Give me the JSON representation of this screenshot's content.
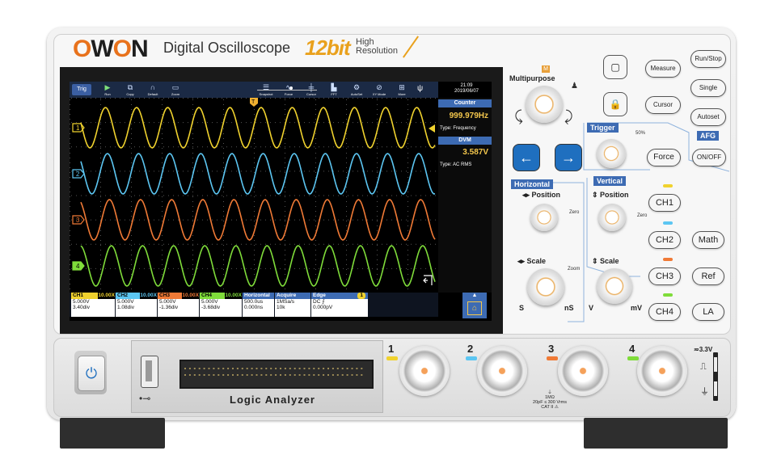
{
  "brand": {
    "logo": "OWON",
    "product": "Digital Oscilloscope",
    "bits": "12bit",
    "hires_line1": "High",
    "hires_line2": "Resolution"
  },
  "toolbar": {
    "trig": "Trig",
    "items": [
      {
        "icon": "play-icon",
        "label": "Run"
      },
      {
        "icon": "copy-icon",
        "label": "Copy"
      },
      {
        "icon": "default-icon",
        "label": "Default"
      },
      {
        "icon": "zoom-icon",
        "label": "Zoom"
      }
    ],
    "right_items": [
      {
        "icon": "snapshot-icon",
        "label": "Snapshot"
      },
      {
        "icon": "force-icon",
        "label": "Force"
      },
      {
        "icon": "cursor-icon",
        "label": "Cursor"
      },
      {
        "icon": "fft-icon",
        "label": "FFT"
      },
      {
        "icon": "autoset-icon",
        "label": "AutoSet"
      },
      {
        "icon": "xy-mode-icon",
        "label": "XY Mode"
      },
      {
        "icon": "more-icon",
        "label": "More"
      }
    ],
    "usb": "ψ",
    "time": "21:09",
    "date": "2019/06/07"
  },
  "trigger_marker": "T",
  "side": {
    "counter_head": "Counter",
    "counter_value": "999.979Hz",
    "counter_type": "Type: Frequency",
    "dvm_head": "DVM",
    "dvm_value": "3.587V",
    "dvm_type": "Type: AC RMS"
  },
  "channel_markers": [
    "1",
    "2",
    "3",
    "4"
  ],
  "status": {
    "ch": [
      {
        "name": "CH1",
        "probe": "10.00X",
        "volt": "5.000V",
        "pos": "3.40div",
        "color": "#f0d22e"
      },
      {
        "name": "CH2",
        "probe": "10.00X",
        "volt": "5.000V",
        "pos": "1.08div",
        "color": "#5cc6f2"
      },
      {
        "name": "CH3",
        "probe": "10.00X",
        "volt": "5.000V",
        "pos": "-1.36div",
        "color": "#f07a36"
      },
      {
        "name": "CH4",
        "probe": "10.00X",
        "volt": "5.000V",
        "pos": "-3.68div",
        "color": "#7fdc3a"
      }
    ],
    "coupling": "═",
    "horizontal": {
      "head": "Horizontal",
      "line1": "500.0us",
      "line2": "0.000ns"
    },
    "acquire": {
      "head": "Acquire",
      "line1": "1MSa/s",
      "line2": "10k"
    },
    "edge": {
      "head": "Edge",
      "badge": "1",
      "line1": "DC ⨍",
      "line2": "0.000pV"
    }
  },
  "panel": {
    "multipurpose": "Multipurpose",
    "m_badge": "M",
    "trigger": "Trigger",
    "fifty": "50%",
    "force": "Force",
    "afg": "AFG",
    "onoff": "ON/OFF",
    "horizontal": "Horizontal",
    "vertical": "Vertical",
    "position": "Position",
    "scale": "Scale",
    "zero": "Zero",
    "zoom": "Zoom",
    "s": "S",
    "ns": "nS",
    "v": "V",
    "mv": "mV",
    "measure": "Measure",
    "cursor": "Cursor",
    "runstop": "Run/Stop",
    "single": "Single",
    "autoset": "Autoset",
    "ch1": "CH1",
    "ch2": "CH2",
    "ch3": "CH3",
    "ch4": "CH4",
    "math": "Math",
    "ref": "Ref",
    "la": "LA"
  },
  "lower": {
    "logic_analyzer": "Logic Analyzer",
    "inputs": [
      "1",
      "2",
      "3",
      "4"
    ],
    "spec1": "1MΩ",
    "spec2": "20pF ≤ 300 Vrms",
    "spec3": "CAT II ⚠",
    "probe_comp": "≂3.3V"
  },
  "colors": {
    "ch1": "#f0d22e",
    "ch2": "#5cc6f2",
    "ch3": "#f07a36",
    "ch4": "#7fdc3a",
    "accent": "#3d6bb3",
    "orange": "#e8721c"
  }
}
